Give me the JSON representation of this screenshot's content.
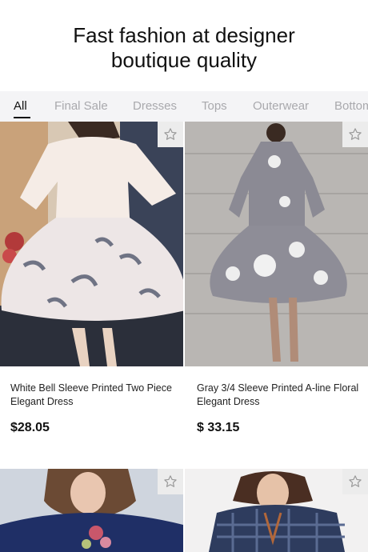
{
  "header": {
    "headline_line1": "Fast fashion at designer",
    "headline_line2": "boutique quality"
  },
  "tabs": [
    {
      "label": "All",
      "active": true
    },
    {
      "label": "Final Sale",
      "active": false
    },
    {
      "label": "Dresses",
      "active": false
    },
    {
      "label": "Tops",
      "active": false
    },
    {
      "label": "Outerwear",
      "active": false
    },
    {
      "label": "Bottoms",
      "active": false
    }
  ],
  "products": [
    {
      "title": "White Bell Sleeve Printed Two Piece Elegant Dress",
      "price": "$28.05",
      "favorite_icon": "star-outline-icon"
    },
    {
      "title": "Gray 3/4 Sleeve Printed A-line Floral Elegant Dress",
      "price": "$ 33.15",
      "favorite_icon": "star-outline-icon"
    },
    {
      "favorite_icon": "star-outline-icon"
    },
    {
      "favorite_icon": "star-outline-icon"
    }
  ],
  "colors": {
    "tab_bar_bg": "#f4f4f6",
    "tab_inactive": "#a9a9ad",
    "tab_active": "#111111",
    "star_button_bg": "#ececec"
  }
}
